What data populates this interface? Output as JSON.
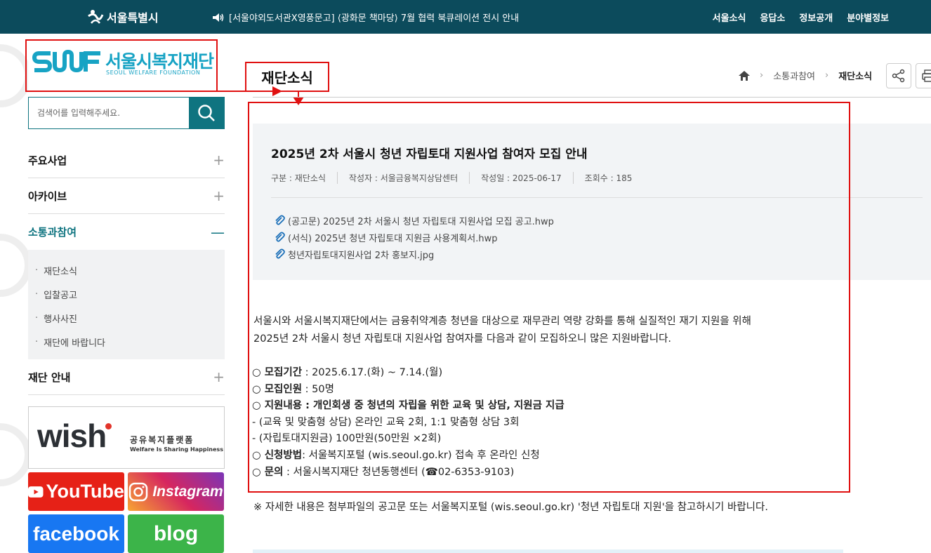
{
  "topbar": {
    "gov_name": "서울특별시",
    "notice": "[서울야외도서관X영풍문고] ⟨광화문 책마당⟩ 7월 협력 북큐레이션 전시 안내",
    "nav": [
      "서울소식",
      "응답소",
      "정보공개",
      "분야별정보"
    ]
  },
  "logo": {
    "ko": "서울시복지재단",
    "en": "SEOUL WELFARE FOUNDATION"
  },
  "search": {
    "placeholder": "검색어를 입력해주세요."
  },
  "menu": {
    "items": [
      "주요사업",
      "아카이브",
      "소통과참여",
      "재단 안내"
    ],
    "submenu": [
      "재단소식",
      "입찰공고",
      "행사사진",
      "재단에 바랍니다"
    ]
  },
  "banners": {
    "wish_word": "wish",
    "wish_ko": "공유복지플랫폼",
    "wish_en": "Welfare Is Sharing Happiness",
    "youtube": "YouTube",
    "instagram": "Instagram",
    "facebook": "facebook",
    "blog": "blog"
  },
  "page": {
    "title": "재단소식",
    "breadcrumb": [
      "소통과참여",
      "재단소식"
    ]
  },
  "post": {
    "title": "2025년 2차 서울시 청년 자립토대 지원사업 참여자 모집 안내",
    "meta": [
      "구분 : 재단소식",
      "작성자 : 서울금융복지상담센터",
      "작성일 : 2025-06-17",
      "조회수 : 185"
    ],
    "files": [
      "(공고문) 2025년 2차 서울시 청년 자립토대 지원사업 모집 공고.hwp",
      "(서식) 2025년 청년 자립토대 지원금 사용계획서.hwp",
      "청년자립토대지원사업 2차 홍보지.jpg"
    ],
    "intro_1": "서울시와 서울시복지재단에서는 금융취약계층 청년을 대상으로 재무관리 역량 강화를 통해 실질적인 재기 지원을 위해",
    "intro_2": "2025년 2차 서울시 청년 자립토대 지원사업 참여자를 다음과 같이 모집하오니 많은 지원바랍니다.",
    "period_label": "○ 모집기간",
    "period_value": " : 2025.6.17.(화) ~ 7.14.(월)",
    "count_label": "○ 모집인원",
    "count_value": " : 50명",
    "content_label": "○ 지원내용",
    "content_value": " : 개인회생 중 청년의 자립을 위한 교육 및 상담, 지원금 지급",
    "content_sub_1": "- (교육 및 맞춤형 상담) 온라인 교육 2회, 1:1 맞춤형 상담 3회",
    "content_sub_2": "- (자립토대지원금) 100만원(50만원 ×2회)",
    "apply_label": "○ 신청방법",
    "apply_value": ": 서울복지포털 (wis.seoul.go.kr) 접속 후 온라인 신청",
    "contact_label": "○ 문의",
    "contact_value": " : 서울시복지재단 청년동행센터 (☎02-6353-9103)",
    "footnote": "※ 자세한 내용은 첨부파일의 공고문 또는 서울복지포털 (wis.seoul.go.kr) '청년 자립토대 지원'을 참고하시기 바랍니다."
  }
}
